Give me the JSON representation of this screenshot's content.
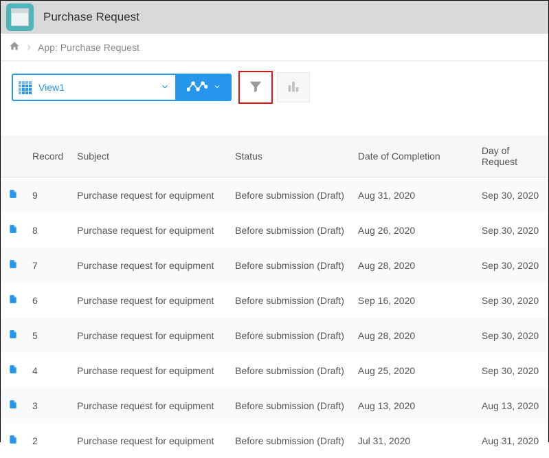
{
  "header": {
    "title": "Purchase Request"
  },
  "breadcrumb": {
    "text": "App: Purchase Request"
  },
  "toolbar": {
    "view_label": "View1"
  },
  "table": {
    "headers": {
      "record": "Record",
      "subject": "Subject",
      "status": "Status",
      "completion": "Date of Completion",
      "request": "Day of Request"
    },
    "rows": [
      {
        "record": "9",
        "subject": "Purchase request for equipment",
        "status": "Before submission (Draft)",
        "completion": "Aug 31, 2020",
        "request": "Sep 30, 2020"
      },
      {
        "record": "8",
        "subject": "Purchase request for equipment",
        "status": "Before submission (Draft)",
        "completion": "Aug 26, 2020",
        "request": "Sep 30, 2020"
      },
      {
        "record": "7",
        "subject": "Purchase request for equipment",
        "status": "Before submission (Draft)",
        "completion": "Aug 28, 2020",
        "request": "Sep 30, 2020"
      },
      {
        "record": "6",
        "subject": "Purchase request for equipment",
        "status": "Before submission (Draft)",
        "completion": "Sep 16, 2020",
        "request": "Sep 30, 2020"
      },
      {
        "record": "5",
        "subject": "Purchase request for equipment",
        "status": "Before submission (Draft)",
        "completion": "Aug 28, 2020",
        "request": "Sep 30, 2020"
      },
      {
        "record": "4",
        "subject": "Purchase request for equipment",
        "status": "Before submission (Draft)",
        "completion": "Aug 25, 2020",
        "request": "Sep 30, 2020"
      },
      {
        "record": "3",
        "subject": "Purchase request for equipment",
        "status": "Before submission (Draft)",
        "completion": "Aug 13, 2020",
        "request": "Aug 13, 2020"
      },
      {
        "record": "2",
        "subject": "Purchase request for equipment",
        "status": "Before submission (Draft)",
        "completion": "Jul 31, 2020",
        "request": "Aug 31, 2020"
      }
    ]
  }
}
